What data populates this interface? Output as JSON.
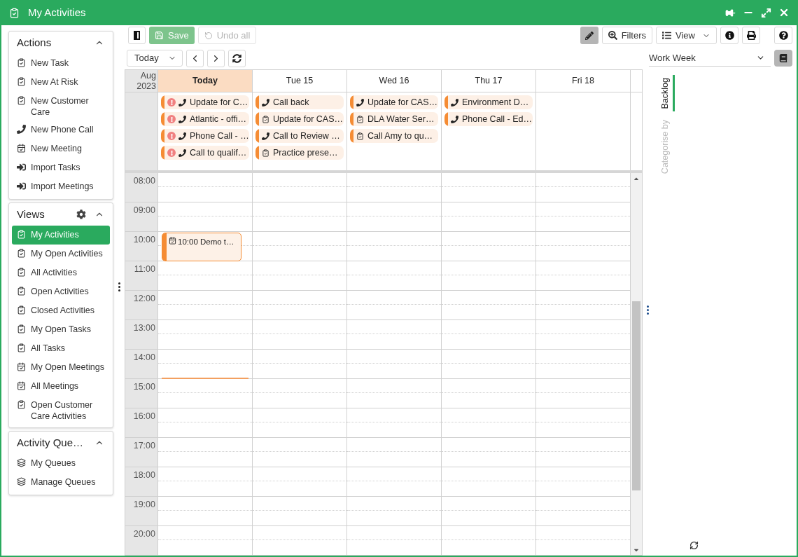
{
  "window": {
    "title": "My Activities"
  },
  "sidebar": {
    "sections": [
      {
        "title": "Actions",
        "settings": false,
        "items": [
          {
            "label": "New Task",
            "kind": "task",
            "selected": false
          },
          {
            "label": "New At Risk",
            "kind": "task",
            "selected": false
          },
          {
            "label": "New Customer Care",
            "kind": "task",
            "selected": false
          },
          {
            "label": "New Phone Call",
            "kind": "phone",
            "selected": false
          },
          {
            "label": "New Meeting",
            "kind": "meeting",
            "selected": false
          },
          {
            "label": "Import Tasks",
            "kind": "import",
            "selected": false
          },
          {
            "label": "Import Meetings",
            "kind": "import",
            "selected": false
          }
        ]
      },
      {
        "title": "Views",
        "settings": true,
        "items": [
          {
            "label": "My Activities",
            "kind": "task",
            "selected": true
          },
          {
            "label": "My Open Activities",
            "kind": "task",
            "selected": false
          },
          {
            "label": "All Activities",
            "kind": "task",
            "selected": false
          },
          {
            "label": "Open Activities",
            "kind": "task",
            "selected": false
          },
          {
            "label": "Closed Activities",
            "kind": "task",
            "selected": false
          },
          {
            "label": "My Open Tasks",
            "kind": "task",
            "selected": false
          },
          {
            "label": "All Tasks",
            "kind": "task",
            "selected": false
          },
          {
            "label": "My Open Meetings",
            "kind": "meeting",
            "selected": false
          },
          {
            "label": "All Meetings",
            "kind": "meeting",
            "selected": false
          },
          {
            "label": "Open Customer Care Activities",
            "kind": "task",
            "selected": false
          }
        ]
      },
      {
        "title": "Activity Que…",
        "settings": false,
        "items": [
          {
            "label": "My Queues",
            "kind": "queue",
            "selected": false
          },
          {
            "label": "Manage Queues",
            "kind": "queue",
            "selected": false
          }
        ]
      }
    ]
  },
  "toolbar": {
    "save": {
      "label": "Save",
      "disabled": true
    },
    "undo": {
      "label": "Undo all",
      "disabled": true
    },
    "edit": {
      "selected": true
    },
    "filters": {
      "label": "Filters"
    },
    "view": {
      "label": "View"
    }
  },
  "navigation": {
    "range": "Today"
  },
  "calendar": {
    "month": "Aug",
    "year": "2023",
    "days": [
      {
        "label": "Today",
        "selected": true,
        "all_day": [
          {
            "title": "Update for C…",
            "kind": "phone",
            "overdue": true
          },
          {
            "title": "Atlantic - offi…",
            "kind": "phone",
            "overdue": true
          },
          {
            "title": "Phone Call - …",
            "kind": "phone",
            "overdue": true
          },
          {
            "title": "Call to qualif…",
            "kind": "phone",
            "overdue": true
          }
        ]
      },
      {
        "label": "Tue 15",
        "selected": false,
        "all_day": [
          {
            "title": "Call back",
            "kind": "phone",
            "overdue": false
          },
          {
            "title": "Update for CAS…",
            "kind": "task",
            "overdue": false
          },
          {
            "title": "Call to Review …",
            "kind": "phone",
            "overdue": false
          },
          {
            "title": "Practice prese…",
            "kind": "task",
            "overdue": false
          }
        ]
      },
      {
        "label": "Wed 16",
        "selected": false,
        "all_day": [
          {
            "title": "Update for CAS…",
            "kind": "phone",
            "overdue": false
          },
          {
            "title": "DLA Water Ser…",
            "kind": "task",
            "overdue": false
          },
          {
            "title": "Call Amy to qu…",
            "kind": "task",
            "overdue": false
          }
        ]
      },
      {
        "label": "Thu 17",
        "selected": false,
        "all_day": [
          {
            "title": "Environment D…",
            "kind": "phone",
            "overdue": false
          },
          {
            "title": "Phone Call - Ed…",
            "kind": "phone",
            "overdue": false
          }
        ]
      },
      {
        "label": "Fri 18",
        "selected": false
      }
    ],
    "hours": [
      {
        "label": "08:00"
      },
      {
        "label": "09:00"
      },
      {
        "label": "10:00",
        "days": [
          {
            "events": [
              {
                "title": "10:00 Demo t…",
                "kind": "meeting"
              }
            ]
          }
        ]
      },
      {
        "label": "11:00"
      },
      {
        "label": "12:00"
      },
      {
        "label": "13:00"
      },
      {
        "label": "14:00"
      },
      {
        "label": "15:00"
      },
      {
        "label": "16:00"
      },
      {
        "label": "17:00"
      },
      {
        "label": "18:00"
      },
      {
        "label": "19:00"
      },
      {
        "label": "20:00"
      }
    ]
  },
  "right_panel": {
    "period": "Work Week",
    "tabs": [
      {
        "label": "Backlog",
        "selected": true
      },
      {
        "label": "Categorise by",
        "selected": false
      }
    ]
  }
}
